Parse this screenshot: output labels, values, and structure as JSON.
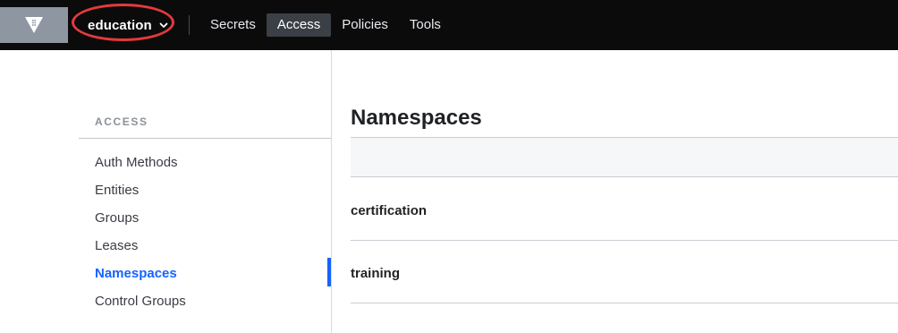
{
  "topbar": {
    "namespace_label": "education",
    "nav": [
      {
        "label": "Secrets"
      },
      {
        "label": "Access"
      },
      {
        "label": "Policies"
      },
      {
        "label": "Tools"
      }
    ],
    "active_nav": "Access"
  },
  "sidebar": {
    "heading": "ACCESS",
    "items": [
      {
        "label": "Auth Methods"
      },
      {
        "label": "Entities"
      },
      {
        "label": "Groups"
      },
      {
        "label": "Leases"
      },
      {
        "label": "Namespaces"
      },
      {
        "label": "Control Groups"
      }
    ],
    "active_item": "Namespaces"
  },
  "main": {
    "title": "Namespaces",
    "namespaces": [
      {
        "name": "certification"
      },
      {
        "name": "training"
      }
    ]
  },
  "colors": {
    "topbar_bg": "#0b0b0c",
    "accent_blue": "#1563ff",
    "highlight_red": "#e53a3a"
  },
  "icons": {
    "logo": "vault-logo-icon",
    "namespace_dropdown": "chevron-down-icon"
  }
}
